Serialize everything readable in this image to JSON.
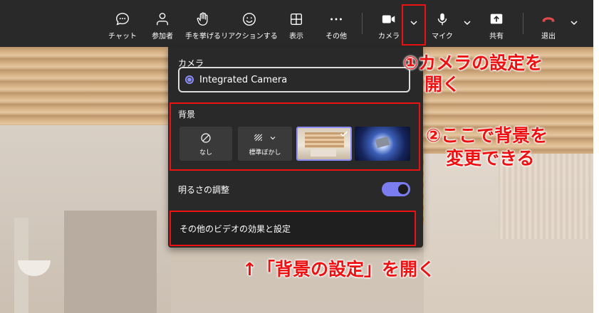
{
  "toolbar": {
    "chat": "チャット",
    "participants": "参加者",
    "raise_hand": "手を挙げる",
    "reactions": "リアクションする",
    "view": "表示",
    "more": "その他",
    "camera": "カメラ",
    "mic": "マイク",
    "share": "共有",
    "leave": "退出"
  },
  "dropdown": {
    "camera_section": "カメラ",
    "camera_device": "Integrated Camera",
    "background_section": "背景",
    "bg_none": "なし",
    "bg_blur": "標準ぼかし",
    "brightness": "明るさの調整",
    "brightness_on": true,
    "more_settings": "その他のビデオの効果と設定"
  },
  "annotations": {
    "step1_line1": "①カメラの設定を",
    "step1_line2": "開く",
    "step2_line1": "②ここで背景を",
    "step2_line2": "変更できる",
    "step3": "↑「背景の設定」を開く"
  },
  "colors": {
    "accent": "#7a7cf0",
    "highlight": "#e11111",
    "leave": "#e04a4a"
  }
}
